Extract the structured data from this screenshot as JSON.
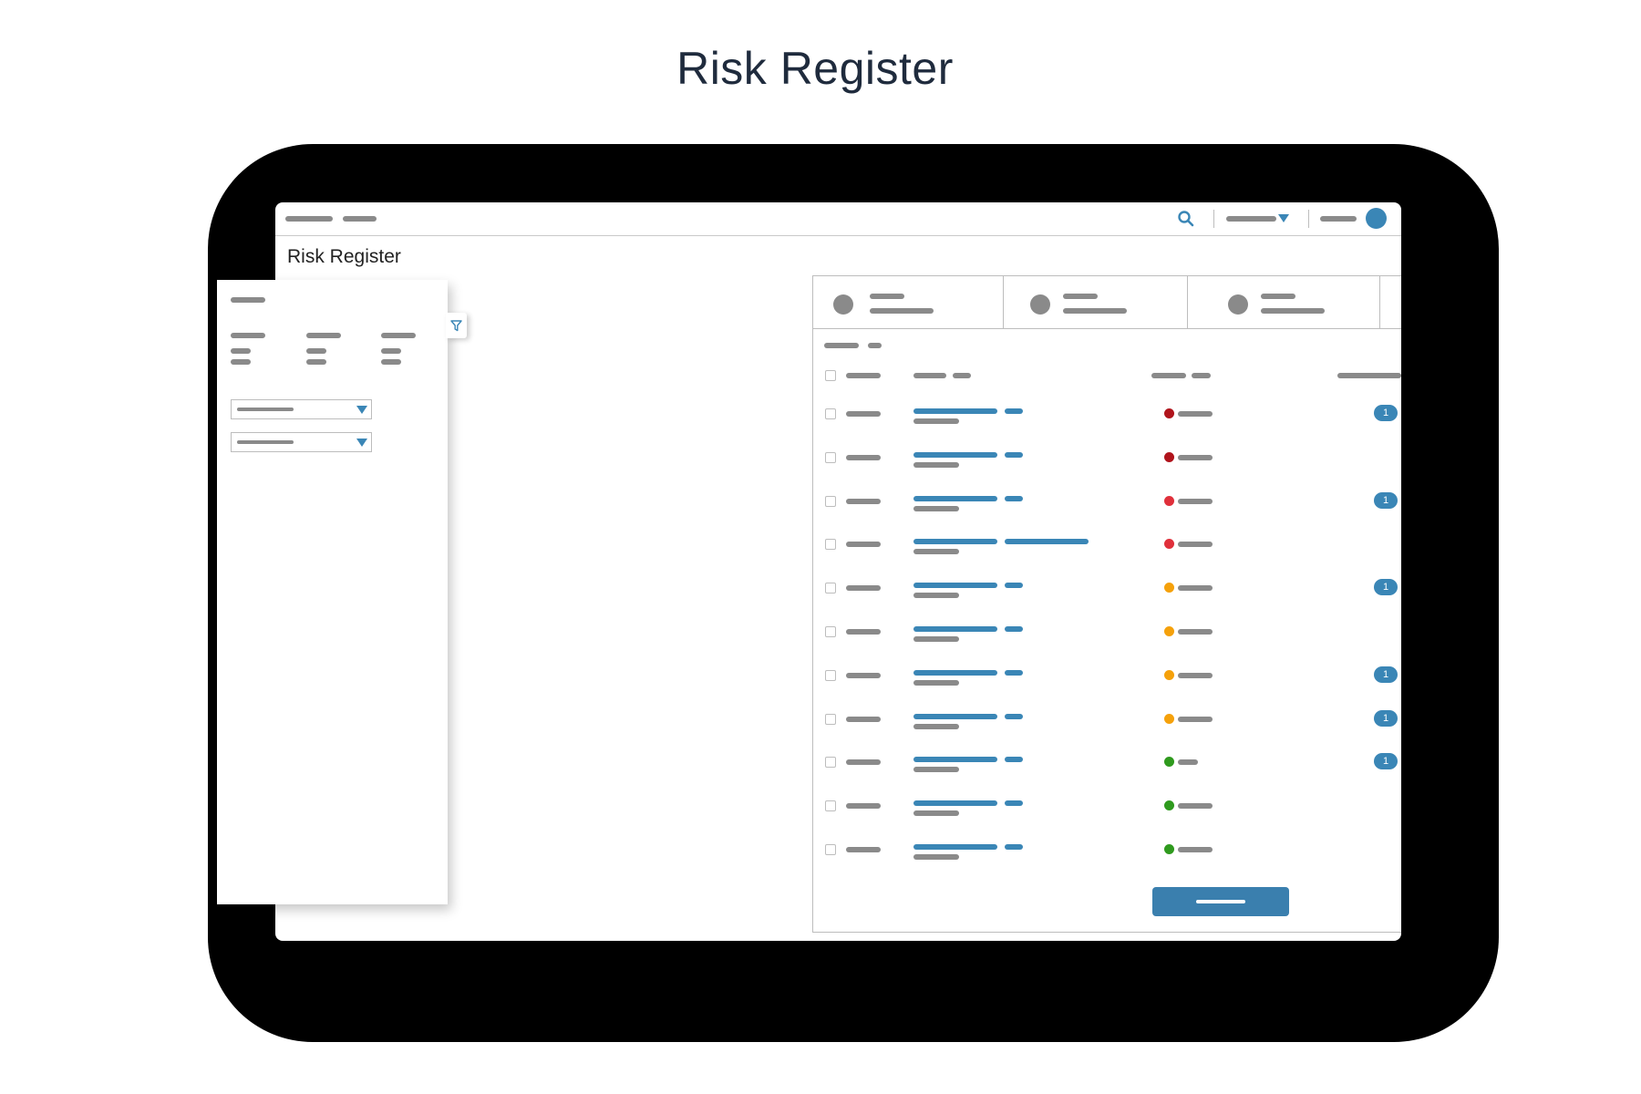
{
  "page": {
    "heading": "Risk Register"
  },
  "app": {
    "page_title": "Risk Register"
  },
  "colors": {
    "accent": "#3a86b6",
    "placeholder": "#8a8a8a",
    "status_critical": "#b0141c",
    "status_high": "#e0303b",
    "status_medium": "#f5a10b",
    "status_low": "#2f9a1e"
  },
  "icons": {
    "search": "search-icon",
    "filter": "filter-icon",
    "add": "plus-icon",
    "refresh": "refresh-icon",
    "more": "kebab-menu-icon",
    "dropdown": "chevron-down-icon"
  },
  "table": {
    "rows": [
      {
        "status": "critical",
        "badge": "1"
      },
      {
        "status": "critical",
        "badge": ""
      },
      {
        "status": "high",
        "badge": "1"
      },
      {
        "status": "high",
        "badge": ""
      },
      {
        "status": "medium",
        "badge": "1"
      },
      {
        "status": "medium",
        "badge": ""
      },
      {
        "status": "medium",
        "badge": "1"
      },
      {
        "status": "medium",
        "badge": "1"
      },
      {
        "status": "low",
        "badge": "1"
      },
      {
        "status": "low",
        "badge": ""
      },
      {
        "status": "low",
        "badge": ""
      }
    ]
  }
}
